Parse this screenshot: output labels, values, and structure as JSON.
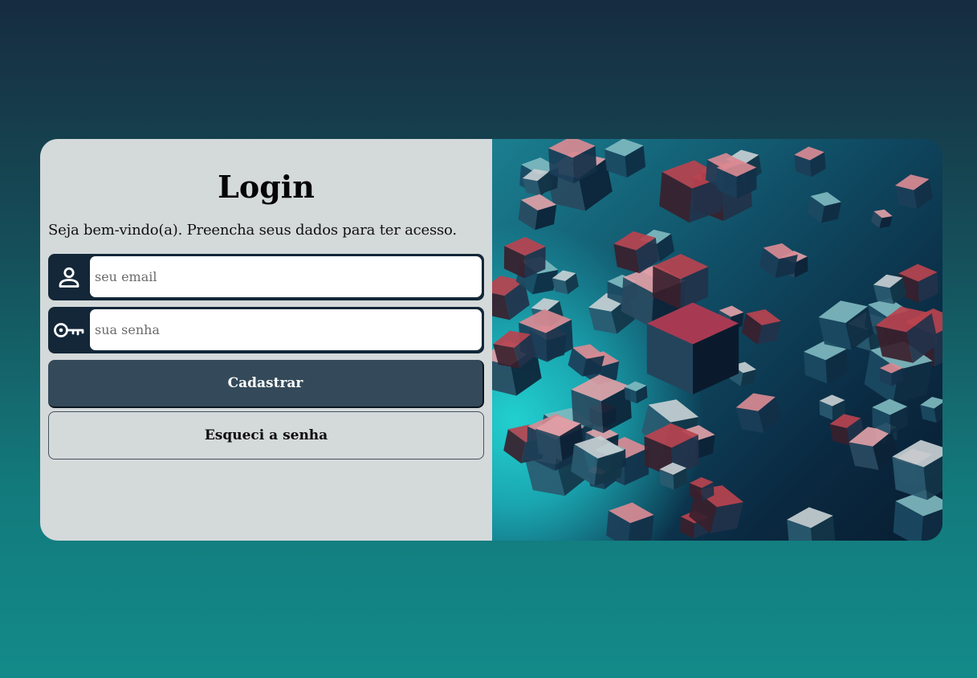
{
  "login": {
    "title": "Login",
    "subtitle": "Seja bem-vindo(a). Preencha seus dados para ter acesso.",
    "email": {
      "icon": "user-icon",
      "placeholder": "seu email",
      "value": ""
    },
    "password": {
      "icon": "key-icon",
      "placeholder": "sua senha",
      "value": ""
    },
    "submit_label": "Cadastrar",
    "forgot_label": "Esqueci a senha"
  },
  "colors": {
    "background_top": "#162c40",
    "background_bottom": "#138a89",
    "panel": "#d4d9da",
    "field_frame": "#132738",
    "primary_button": "#344a5a"
  },
  "hero_image": {
    "subject": "abstract 3D cubes"
  }
}
